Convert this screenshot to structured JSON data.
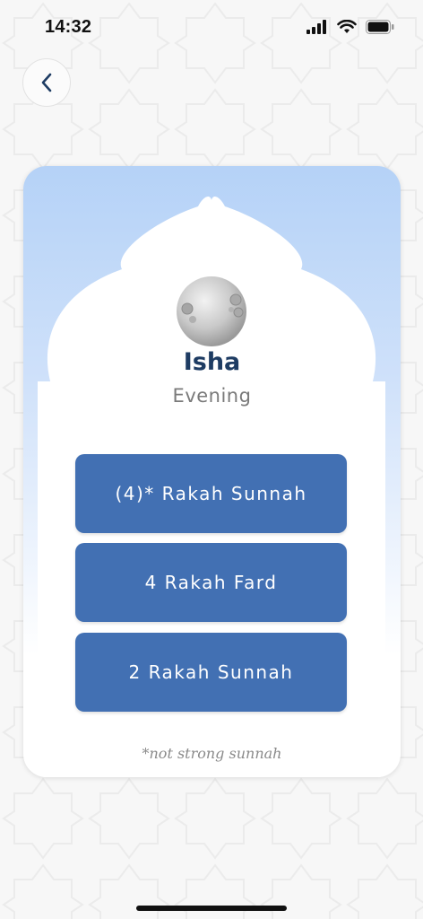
{
  "status_bar": {
    "time": "14:32",
    "icons": [
      "signal-icon",
      "wifi-icon",
      "battery-icon"
    ]
  },
  "nav": {
    "back_icon": "chevron-left-icon"
  },
  "prayer": {
    "name": "Isha",
    "subtitle": "Evening",
    "icon": "moon-icon"
  },
  "rakah_options": [
    {
      "label": "(4)* Rakah Sunnah"
    },
    {
      "label": "4 Rakah Fard"
    },
    {
      "label": "2 Rakah Sunnah"
    }
  ],
  "footnote": "*not strong sunnah",
  "colors": {
    "button": "#4270b3",
    "title": "#1e3c63",
    "card_gradient_top": "#b5d2f7"
  }
}
